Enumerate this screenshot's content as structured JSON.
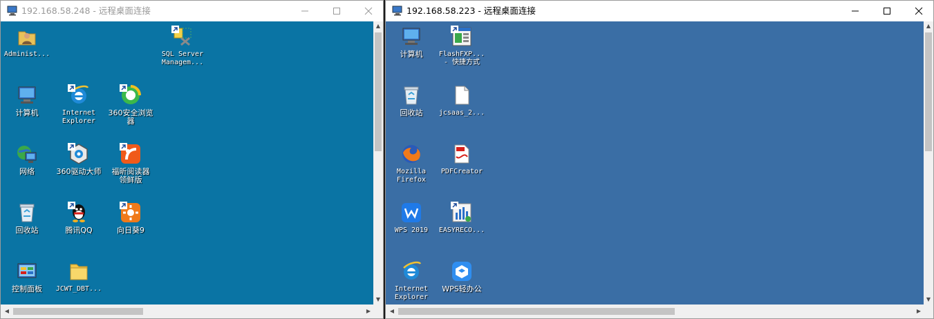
{
  "left_window": {
    "title": "192.168.58.248 - 远程桌面连接",
    "icons": [
      {
        "label": "Administ...",
        "icon": "user-folder-icon"
      },
      {
        "label": "SQL Server\nManagem...",
        "icon": "sql-server-icon"
      },
      {
        "label": "计算机",
        "icon": "computer-icon"
      },
      {
        "label": "Internet\nExplorer",
        "icon": "internet-explorer-icon"
      },
      {
        "label": "360安全浏览\n器",
        "icon": "360-browser-icon"
      },
      {
        "label": "网络",
        "icon": "network-icon"
      },
      {
        "label": "360驱动大师",
        "icon": "360-driver-icon"
      },
      {
        "label": "福昕阅读器\n领鲜版",
        "icon": "foxit-reader-icon"
      },
      {
        "label": "回收站",
        "icon": "recycle-bin-icon"
      },
      {
        "label": "腾讯QQ",
        "icon": "qq-icon"
      },
      {
        "label": "向日葵9",
        "icon": "sunflower-icon"
      },
      {
        "label": "控制面板",
        "icon": "control-panel-icon"
      },
      {
        "label": "JCWT_DBT...",
        "icon": "folder-icon"
      }
    ]
  },
  "right_window": {
    "title": "192.168.58.223 - 远程桌面连接",
    "icons": [
      {
        "label": "计算机",
        "icon": "computer-icon"
      },
      {
        "label": "FlashFXP...\n- 快捷方式",
        "icon": "flashfxp-icon"
      },
      {
        "label": "回收站",
        "icon": "recycle-bin-icon"
      },
      {
        "label": "jcsaas_2...",
        "icon": "file-icon"
      },
      {
        "label": "Mozilla\nFirefox",
        "icon": "firefox-icon"
      },
      {
        "label": "PDFCreator",
        "icon": "pdfcreator-icon"
      },
      {
        "label": "WPS 2019",
        "icon": "wps-icon"
      },
      {
        "label": "EASYRECO...",
        "icon": "easyrecovery-icon"
      },
      {
        "label": "Internet\nExplorer",
        "icon": "internet-explorer-icon"
      },
      {
        "label": "WPS轻办公",
        "icon": "wps-light-office-icon"
      }
    ]
  },
  "colors": {
    "left_desktop": "#0a74a4",
    "right_desktop": "#3a6ea5",
    "title_active": "#000000",
    "title_inactive": "#999999"
  }
}
